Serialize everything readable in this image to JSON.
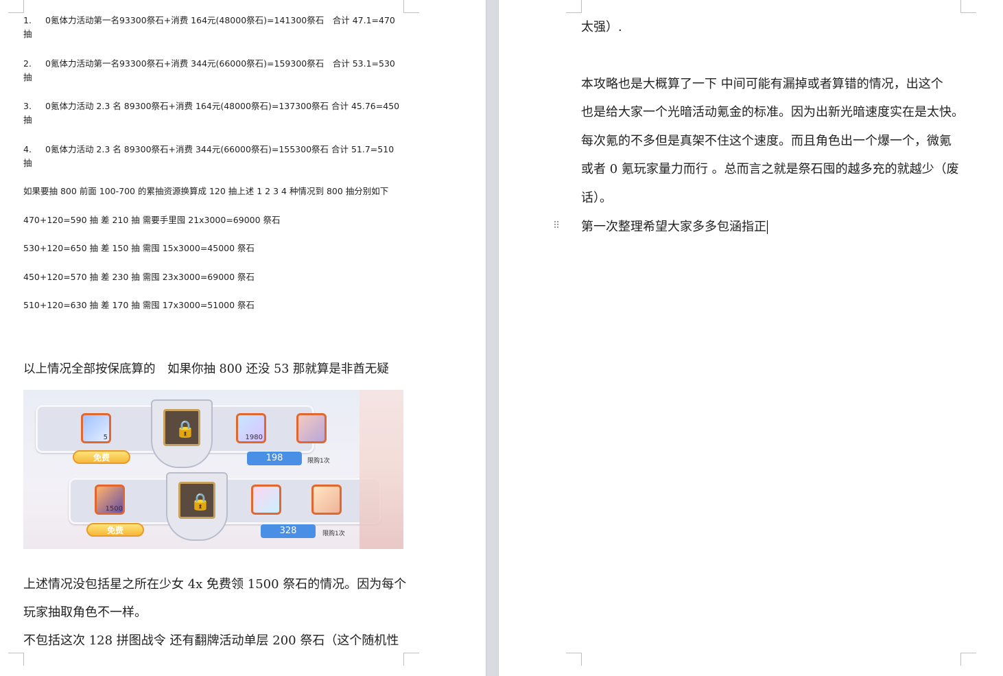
{
  "left_page": {
    "list_items": [
      {
        "number": "1.",
        "text": "0氪体力活动第一名93300祭石+消费 164元(48000祭石)=141300祭石　合计 47.1=470",
        "wrap": "抽"
      },
      {
        "number": "2.",
        "text": "0氪体力活动第一名93300祭石+消费 344元(66000祭石)=159300祭石　合计 53.1=530",
        "wrap": "抽"
      },
      {
        "number": "3.",
        "text": "0氪体力活动 2.3 名  89300祭石+消费 164元(48000祭石)=137300祭石  合计 45.76=450",
        "wrap": "抽"
      },
      {
        "number": "4.",
        "text": "0氪体力活动 2.3 名  89300祭石+消费 344元(66000祭石)=155300祭石  合计 51.7=510",
        "wrap": "抽"
      }
    ],
    "summary_line": "如果要抽 800  前面 100-700 的累抽资源换算成 120 抽上述 1 2 3 4 种情况到 800 抽分别如下",
    "calc_lines": [
      "470+120=590 抽  差 210 抽  需要手里囤 21x3000=69000 祭石",
      "530+120=650 抽  差 150 抽  需囤 15x3000=45000 祭石",
      "450+120=570 抽  差 230 抽  需囤 23x3000=69000 祭石",
      "510+120=630 抽  差 170 抽  需囤 17x3000=51000 祭石"
    ],
    "para_guarantee": "以上情况全部按保底算的　如果你抽 800 还没 53 那就算是非酋无疑",
    "screenshot": {
      "row1": {
        "item1_count": "5",
        "free_label": "免费",
        "item3_count": "1980",
        "price": "198",
        "limit": "限购1次"
      },
      "row2": {
        "item1_count": "1500",
        "free_label": "免费",
        "price": "328",
        "limit": "限购1次"
      }
    },
    "para_not_included_1a": "上述情况没包括星之所在少女 4x 免费领 1500 祭石的情况。因为每个",
    "para_not_included_1b": "玩家抽取角色不一样。",
    "para_not_included_2": "不包括这次 128 拼图战令  还有翻牌活动单层 200 祭石（这个随机性"
  },
  "right_page": {
    "line_top": "太强）.",
    "para_lines": [
      "本攻略也是大概算了一下  中间可能有漏掉或者算错的情况，出这个",
      "也是给大家一个光暗活动氪金的标准。因为出新光暗速度实在是太快。",
      "每次氪的不多但是真架不住这个速度。而且角色出一个爆一个，微氪",
      "或者 0 氪玩家量力而行  。总而言之就是祭石囤的越多充的就越少（废",
      "话）。"
    ],
    "last_line": "第一次整理希望大家多多包涵指正",
    "drag_handle_glyph": "⠿"
  },
  "colors": {
    "gutter": "#d9dbe0",
    "accent_orange": "#e0682e",
    "price_blue": "#4a8fe6"
  }
}
